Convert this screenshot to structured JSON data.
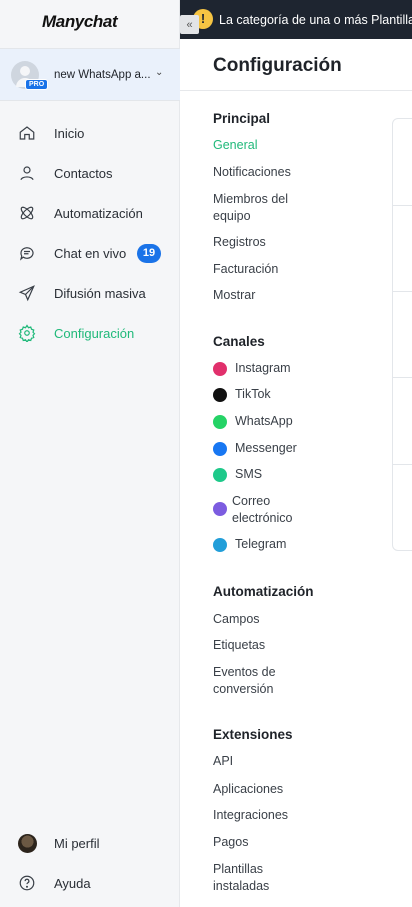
{
  "app": {
    "logo": "Manychat"
  },
  "account": {
    "name": "new WhatsApp a...",
    "badge": "PRO"
  },
  "nav": [
    {
      "label": "Inicio",
      "icon": "home-icon",
      "active": false
    },
    {
      "label": "Contactos",
      "icon": "user-icon",
      "active": false
    },
    {
      "label": "Automatización",
      "icon": "atom-icon",
      "active": false
    },
    {
      "label": "Chat en vivo",
      "icon": "chat-icon",
      "active": false,
      "badge": "19"
    },
    {
      "label": "Difusión masiva",
      "icon": "send-icon",
      "active": false
    },
    {
      "label": "Configuración",
      "icon": "gear-icon",
      "active": true
    }
  ],
  "footer": {
    "profile_label": "Mi perfil",
    "help_label": "Ayuda"
  },
  "banner": {
    "text": "La categoría de una o más Plantillas de Mensaje ha cambiado"
  },
  "page": {
    "title": "Configuración"
  },
  "settings_nav": {
    "principal": {
      "title": "Principal",
      "items": [
        "General",
        "Notificaciones",
        "Miembros del equipo",
        "Registros",
        "Facturación",
        "Mostrar"
      ],
      "active": "General"
    },
    "canales": {
      "title": "Canales",
      "items": [
        {
          "label": "Instagram",
          "icon": "instagram-icon",
          "color": "#e1306c"
        },
        {
          "label": "TikTok",
          "icon": "tiktok-icon",
          "color": "#111111"
        },
        {
          "label": "WhatsApp",
          "icon": "whatsapp-icon",
          "color": "#25d366"
        },
        {
          "label": "Messenger",
          "icon": "messenger-icon",
          "color": "#1877f2"
        },
        {
          "label": "SMS",
          "icon": "sms-icon",
          "color": "#1ec98a"
        },
        {
          "label": "Correo electrónico",
          "icon": "email-icon",
          "color": "#7c5ce0"
        },
        {
          "label": "Telegram",
          "icon": "telegram-icon",
          "color": "#229ed9"
        }
      ]
    },
    "automatizacion": {
      "title": "Automatización",
      "items": [
        "Campos",
        "Etiquetas",
        "Eventos de conversión"
      ]
    },
    "extensiones": {
      "title": "Extensiones",
      "items": [
        "API",
        "Aplicaciones",
        "Integraciones",
        "Pagos",
        "Plantillas instaladas"
      ]
    }
  },
  "colors": {
    "accent": "#20b97a",
    "badge": "#1a73e8",
    "banner_bg": "#1e2530",
    "warning": "#f6c443"
  }
}
